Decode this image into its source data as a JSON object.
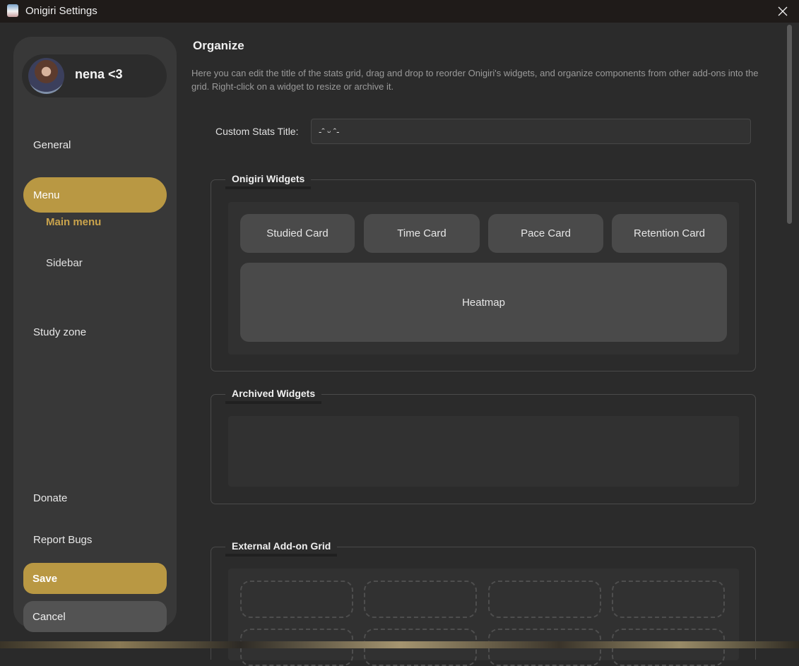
{
  "window": {
    "title": "Onigiri Settings"
  },
  "profile": {
    "name": "nena <3"
  },
  "sidebar": {
    "items": [
      {
        "label": "General"
      },
      {
        "label": "Menu"
      },
      {
        "label": "Study zone"
      },
      {
        "label": "Donate"
      },
      {
        "label": "Report Bugs"
      }
    ],
    "sub_items": [
      {
        "label": "Main menu"
      },
      {
        "label": "Sidebar"
      }
    ],
    "save_label": "Save",
    "cancel_label": "Cancel"
  },
  "main": {
    "title": "Organize",
    "description": "Here you can edit the title of the stats grid, drag and drop to reorder Onigiri's widgets, and organize components from other add-ons into the grid. Right-click on a widget to resize or archive it.",
    "custom_title_label": "Custom Stats Title:",
    "custom_title_value": "-ˆ ᵕ ˆ-",
    "onigiri_widgets": {
      "title": "Onigiri Widgets",
      "widgets": [
        "Studied Card",
        "Time Card",
        "Pace Card",
        "Retention Card",
        "Heatmap"
      ]
    },
    "archived_widgets": {
      "title": "Archived Widgets"
    },
    "external_grid": {
      "title": "External Add-on Grid"
    }
  },
  "colors": {
    "accent": "#b99843",
    "background": "#2b2b2b",
    "sidebar": "#383838",
    "widget": "#4a4a4a"
  }
}
